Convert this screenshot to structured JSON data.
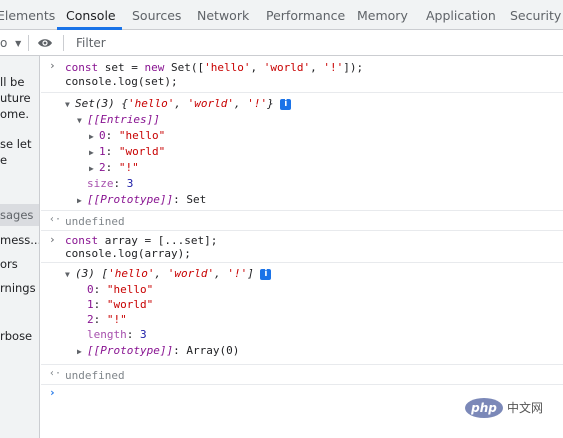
{
  "tabs": [
    {
      "label": "Elements",
      "active": false
    },
    {
      "label": "Console",
      "active": true
    },
    {
      "label": "Sources",
      "active": false
    },
    {
      "label": "Network",
      "active": false
    },
    {
      "label": "Performance",
      "active": false
    },
    {
      "label": "Memory",
      "active": false
    },
    {
      "label": "Application",
      "active": false
    },
    {
      "label": "Security",
      "active": false
    }
  ],
  "toolbar": {
    "context_label": "o",
    "context_arrow": "▼",
    "eye_icon": "eye-icon",
    "filter_placeholder": "Filter"
  },
  "sidebar": {
    "notice_lines": [
      "ll be",
      "uture",
      "ome.",
      "se let",
      "e"
    ],
    "items": [
      "sages",
      "mess...",
      "ors",
      "rnings",
      "rbose"
    ],
    "selected_index": 0
  },
  "console": {
    "entry1": {
      "code_line1": {
        "k": "const",
        "v": " set = ",
        "k2": "new",
        "rest": " Set([",
        "s1": "'hello'",
        "c1": ", ",
        "s2": "'world'",
        "c2": ", ",
        "s3": "'!'",
        "end": "]);"
      },
      "code_line2": "console.log(set);"
    },
    "set_output": {
      "summary_prefix": "Set(3) {",
      "summary_values": [
        "'hello'",
        "'world'",
        "'!'"
      ],
      "summary_suffix": "}",
      "entries_label": "[[Entries]]",
      "entries": [
        {
          "index": "0",
          "value": "\"hello\""
        },
        {
          "index": "1",
          "value": "\"world\""
        },
        {
          "index": "2",
          "value": "\"!\""
        }
      ],
      "size_key": "size",
      "size_value": "3",
      "prototype_key": "[[Prototype]]",
      "prototype_value": "Set"
    },
    "undefined1": "undefined",
    "entry2": {
      "code_line1": {
        "k": "const",
        "v": " array = [...set];"
      },
      "code_line2": "console.log(array);"
    },
    "array_output": {
      "summary_prefix": "(3) [",
      "summary_values": [
        "'hello'",
        "'world'",
        "'!'"
      ],
      "summary_suffix": "]",
      "items": [
        {
          "index": "0",
          "value": "\"hello\""
        },
        {
          "index": "1",
          "value": "\"world\""
        },
        {
          "index": "2",
          "value": "\"!\""
        }
      ],
      "length_key": "length",
      "length_value": "3",
      "prototype_key": "[[Prototype]]",
      "prototype_value": "Array(0)"
    },
    "undefined2": "undefined",
    "prompt_symbol": "›",
    "result_symbol": "‹·"
  },
  "watermark": {
    "logo": "php",
    "text": "中文网"
  },
  "colors": {
    "accent": "#1a73e8",
    "keyword": "#881391",
    "string": "#c80000",
    "number": "#1a1aa6"
  }
}
